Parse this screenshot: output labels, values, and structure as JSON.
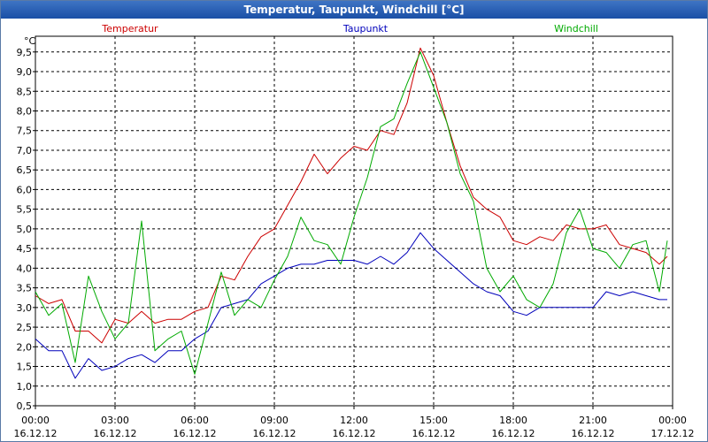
{
  "window": {
    "title": "Temperatur, Taupunkt, Windchill [°C]"
  },
  "chart_data": {
    "type": "line",
    "title": "Temperatur, Taupunkt, Windchill [°C]",
    "ylabel": "°C",
    "ylim": [
      0.5,
      9.9
    ],
    "yticks": [
      "0,5",
      "1,0",
      "1,5",
      "2,0",
      "2,5",
      "3,0",
      "3,5",
      "4,0",
      "4,5",
      "5,0",
      "5,5",
      "6,0",
      "6,5",
      "7,0",
      "7,5",
      "8,0",
      "8,5",
      "9,0",
      "9,5"
    ],
    "xlim": [
      0,
      24
    ],
    "xticks": [
      {
        "time": "00:00",
        "date": "16.12.12"
      },
      {
        "time": "03:00",
        "date": "16.12.12"
      },
      {
        "time": "06:00",
        "date": "16.12.12"
      },
      {
        "time": "09:00",
        "date": "16.12.12"
      },
      {
        "time": "12:00",
        "date": "16.12.12"
      },
      {
        "time": "15:00",
        "date": "16.12.12"
      },
      {
        "time": "18:00",
        "date": "16.12.12"
      },
      {
        "time": "21:00",
        "date": "16.12.12"
      },
      {
        "time": "00:00",
        "date": "17.12.12"
      }
    ],
    "grid": true,
    "legend_position": "top",
    "series": [
      {
        "name": "Temperatur",
        "color": "#cc0000",
        "x": [
          0,
          0.5,
          1,
          1.5,
          2,
          2.5,
          3,
          3.5,
          4,
          4.5,
          5,
          5.5,
          6,
          6.5,
          7,
          7.5,
          8,
          8.5,
          9,
          9.5,
          10,
          10.5,
          11,
          11.5,
          12,
          12.5,
          13,
          13.5,
          14,
          14.5,
          15,
          15.5,
          16,
          16.5,
          17,
          17.5,
          18,
          18.5,
          19,
          19.5,
          20,
          20.5,
          21,
          21.5,
          22,
          22.5,
          23,
          23.5,
          23.8
        ],
        "y": [
          3.3,
          3.1,
          3.2,
          2.4,
          2.4,
          2.1,
          2.7,
          2.6,
          2.9,
          2.6,
          2.7,
          2.7,
          2.9,
          3.0,
          3.8,
          3.7,
          4.3,
          4.8,
          5.0,
          5.6,
          6.2,
          6.9,
          6.4,
          6.8,
          7.1,
          7.0,
          7.5,
          7.4,
          8.2,
          9.6,
          8.9,
          7.7,
          6.6,
          5.8,
          5.5,
          5.3,
          4.7,
          4.6,
          4.8,
          4.7,
          5.1,
          5.0,
          5.0,
          5.1,
          4.6,
          4.5,
          4.4,
          4.1,
          4.3
        ]
      },
      {
        "name": "Taupunkt",
        "color": "#0000bb",
        "x": [
          0,
          0.5,
          1,
          1.5,
          2,
          2.5,
          3,
          3.5,
          4,
          4.5,
          5,
          5.5,
          6,
          6.5,
          7,
          7.5,
          8,
          8.5,
          9,
          9.5,
          10,
          10.5,
          11,
          11.5,
          12,
          12.5,
          13,
          13.5,
          14,
          14.5,
          15,
          15.5,
          16,
          16.5,
          17,
          17.5,
          18,
          18.5,
          19,
          19.5,
          20,
          20.5,
          21,
          21.5,
          22,
          22.5,
          23,
          23.5,
          23.8
        ],
        "y": [
          2.2,
          1.9,
          1.9,
          1.2,
          1.7,
          1.4,
          1.5,
          1.7,
          1.8,
          1.6,
          1.9,
          1.9,
          2.2,
          2.4,
          3.0,
          3.1,
          3.2,
          3.6,
          3.8,
          4.0,
          4.1,
          4.1,
          4.2,
          4.2,
          4.2,
          4.1,
          4.3,
          4.1,
          4.4,
          4.9,
          4.5,
          4.2,
          3.9,
          3.6,
          3.4,
          3.3,
          2.9,
          2.8,
          3.0,
          3.0,
          3.0,
          3.0,
          3.0,
          3.4,
          3.3,
          3.4,
          3.3,
          3.2,
          3.2
        ]
      },
      {
        "name": "Windchill",
        "color": "#00aa00",
        "x": [
          0,
          0.5,
          1,
          1.5,
          2,
          2.5,
          3,
          3.5,
          4,
          4.5,
          5,
          5.5,
          6,
          6.5,
          7,
          7.5,
          8,
          8.5,
          9,
          9.5,
          10,
          10.5,
          11,
          11.5,
          12,
          12.5,
          13,
          13.5,
          14,
          14.5,
          15,
          15.5,
          16,
          16.5,
          17,
          17.5,
          18,
          18.5,
          19,
          19.5,
          20,
          20.5,
          21,
          21.5,
          22,
          22.5,
          23,
          23.5,
          23.8
        ],
        "y": [
          3.4,
          2.8,
          3.1,
          1.6,
          3.8,
          2.9,
          2.2,
          2.6,
          5.2,
          1.9,
          2.2,
          2.4,
          1.3,
          2.6,
          3.9,
          2.8,
          3.2,
          3.0,
          3.7,
          4.3,
          5.3,
          4.7,
          4.6,
          4.1,
          5.3,
          6.3,
          7.6,
          7.8,
          8.7,
          9.5,
          8.6,
          7.7,
          6.4,
          5.7,
          4.0,
          3.4,
          3.8,
          3.2,
          3.0,
          3.6,
          4.9,
          5.5,
          4.5,
          4.4,
          4.0,
          4.6,
          4.7,
          3.4,
          4.7
        ]
      }
    ]
  }
}
